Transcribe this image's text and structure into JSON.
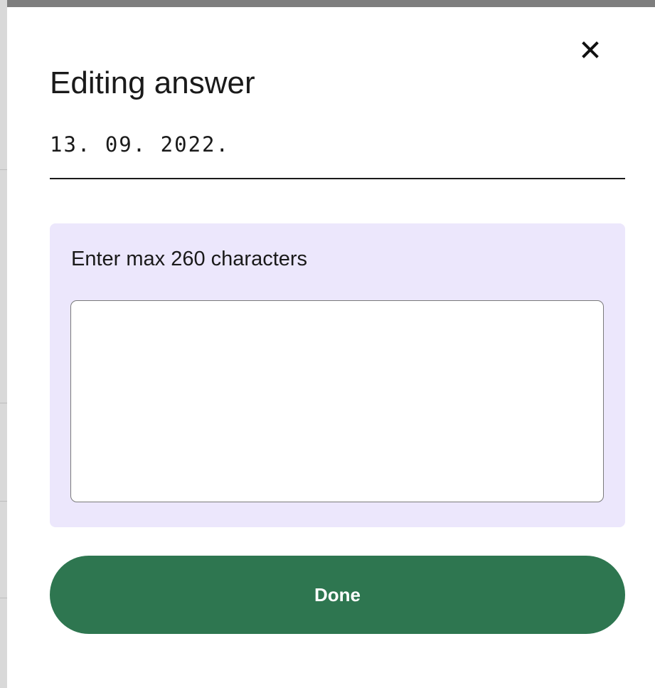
{
  "modal": {
    "title": "Editing answer",
    "date_value": "13. 09. 2022.",
    "close_icon": "close-icon"
  },
  "note": {
    "label": "Enter max 260 characters",
    "value": "",
    "max_length": "260"
  },
  "actions": {
    "done_label": "Done"
  },
  "colors": {
    "accent_green": "#2e7650",
    "panel_lavender": "#ece7fc",
    "backdrop_gray": "#7e7e7e"
  }
}
